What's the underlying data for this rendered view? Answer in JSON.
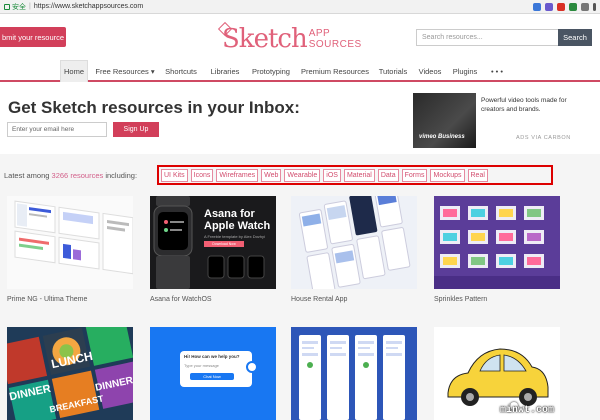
{
  "browser": {
    "secure_label": "安全",
    "url": "https://www.sketchappsources.com"
  },
  "header": {
    "submit_label": "bmit your resource",
    "logo_main": "Sketch",
    "logo_app": "APP",
    "logo_sources": "SOURCES",
    "search_placeholder": "Search resources...",
    "search_label": "Search"
  },
  "nav": {
    "items": [
      {
        "label": "Home",
        "active": true
      },
      {
        "label": "Free Resources ▾"
      },
      {
        "label": "Shortcuts"
      },
      {
        "label": "Libraries"
      },
      {
        "label": "Prototyping"
      },
      {
        "label": "Premium Resources"
      },
      {
        "label": "Tutorials"
      },
      {
        "label": "Videos"
      },
      {
        "label": "Plugins"
      },
      {
        "label": "• • •"
      }
    ]
  },
  "newsletter": {
    "title": "Get Sketch resources in your Inbox:",
    "email_placeholder": "Enter your email here",
    "signup_label": "Sign Up"
  },
  "ad": {
    "brand": "vimeo Business",
    "text": "Powerful video tools made for creators and brands.",
    "via": "ADS VIA CARBON"
  },
  "latest": {
    "prefix": "Latest among",
    "count": "3266 resources",
    "suffix": "including:",
    "tags": [
      "UI Kits",
      "Icons",
      "Wireframes",
      "Web",
      "Wearable",
      "iOS",
      "Material",
      "Data",
      "Forms",
      "Mockups",
      "Real"
    ]
  },
  "cards": [
    {
      "title": "Prime NG - Ultima Theme"
    },
    {
      "title": "Asana for WatchOS",
      "hero": "Asana for Apple Watch",
      "tag": "A Freebie template by Alex Dovhyi",
      "button": "Download Now"
    },
    {
      "title": "House Rental App"
    },
    {
      "title": "Sprinkles Pattern"
    },
    {
      "title": "",
      "words": [
        "LUNCH",
        "DINNER",
        "BREAKFAST",
        "DINNER"
      ]
    },
    {
      "title": "",
      "chat": "Hi! How can we help you?",
      "chat_sub": "Type your message",
      "chat_btn": "Chat Now"
    },
    {
      "title": ""
    },
    {
      "title": ""
    }
  ],
  "watermark": "minwt.com",
  "colors": {
    "accent": "#d23f5a",
    "nav_rule": "#cf4a63",
    "highlight_box": "#dd0000",
    "search_button": "#4a5563"
  }
}
